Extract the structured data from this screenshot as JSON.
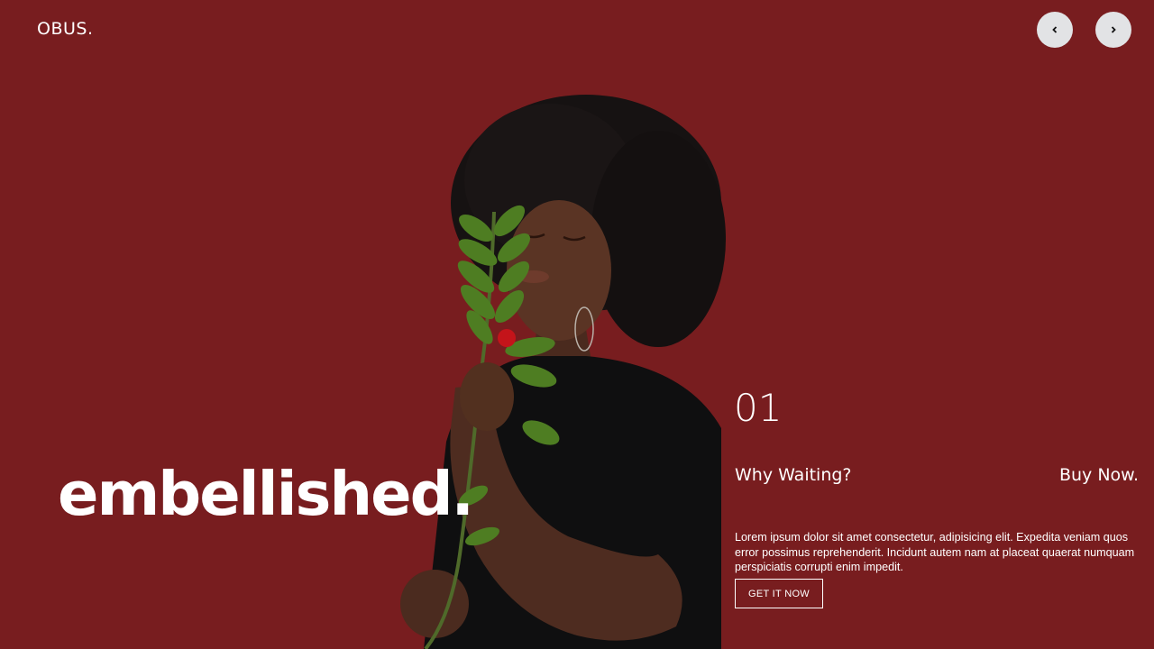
{
  "brand": {
    "logo_text": "OBUS."
  },
  "nav": {
    "prev_icon": "chevron-left-icon",
    "next_icon": "chevron-right-icon"
  },
  "hero": {
    "headline": "embellished.",
    "slide_number": "01",
    "tagline_left": "Why Waiting?",
    "tagline_right": "Buy Now.",
    "description": "Lorem ipsum dolor sit amet consectetur, adipisicing elit. Expedita veniam quos error possimus reprehenderit. Incidunt autem nam at placeat quaerat numquam perspiciatis corrupti enim impedit.",
    "cta_label": "GET IT NOW"
  },
  "colors": {
    "background": "#781d1f",
    "text": "#ffffff",
    "nav_button": "#e2e3e5"
  }
}
